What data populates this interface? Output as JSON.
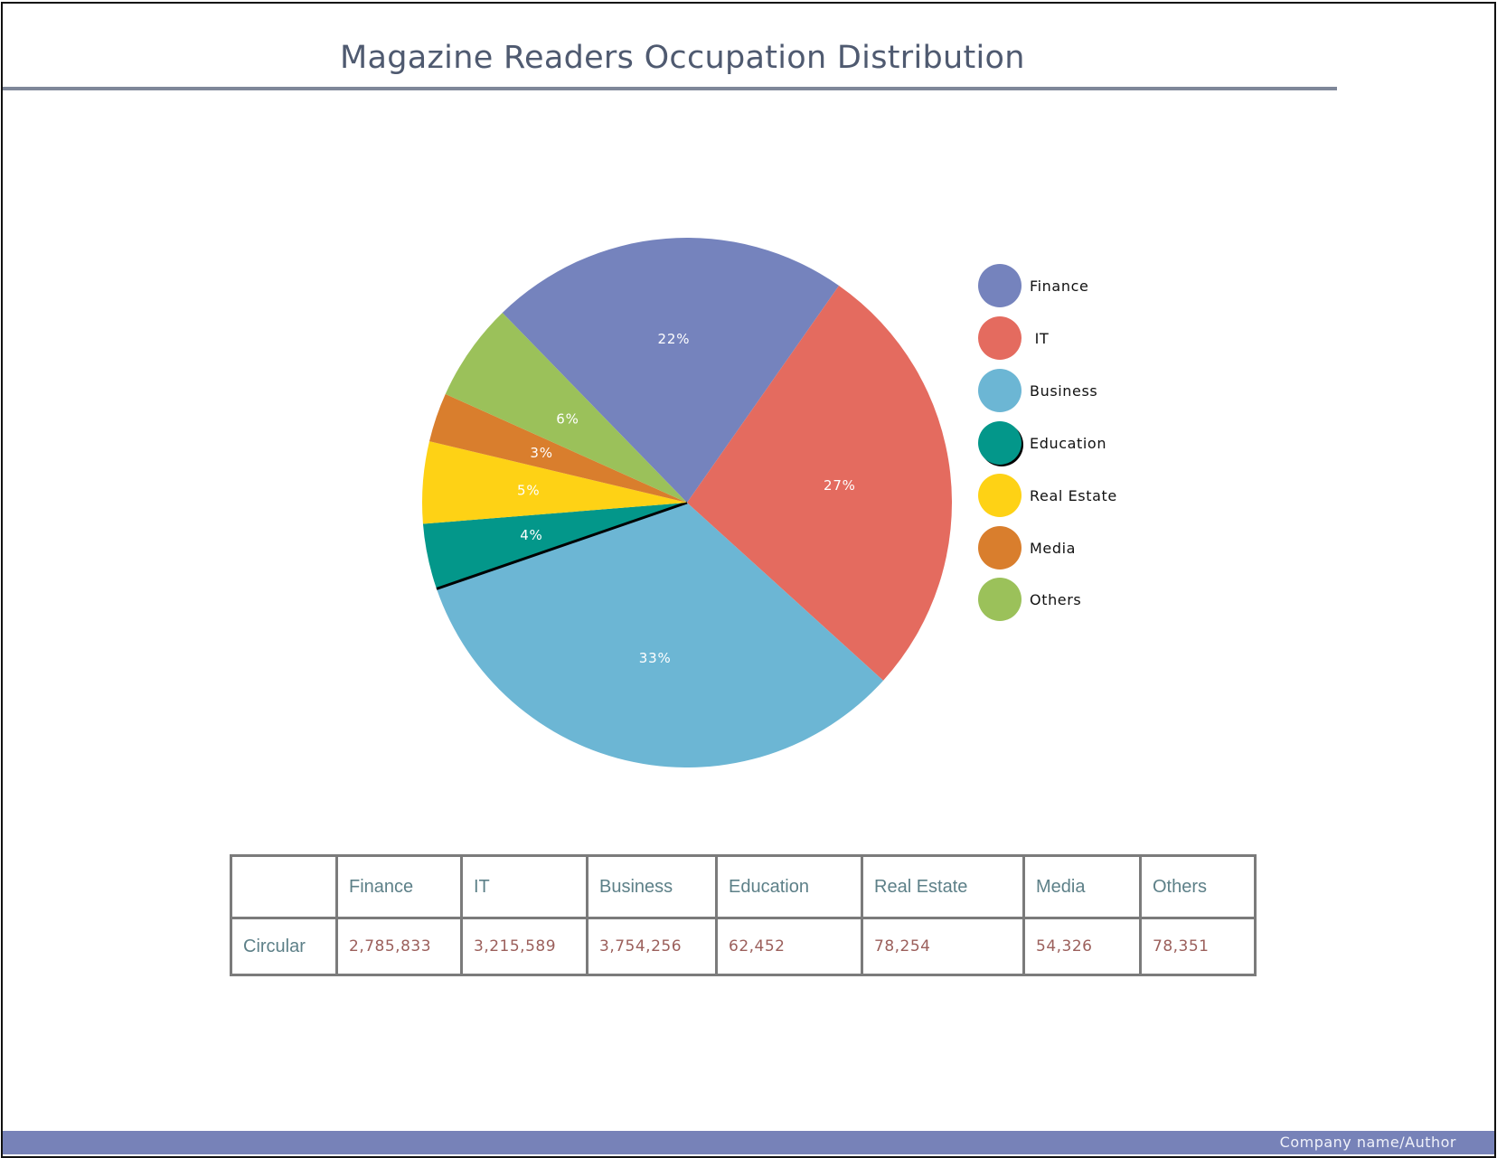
{
  "chart_data": {
    "type": "pie",
    "title": "Magazine Readers Occupation Distribution",
    "slices": [
      {
        "label": "Finance",
        "percent": 22,
        "value": 2785833,
        "color": "#7583bd"
      },
      {
        "label": "IT",
        "percent": 27,
        "value": 3215589,
        "color": "#e46b5f"
      },
      {
        "label": "Business",
        "percent": 33,
        "value": 3754256,
        "color": "#6cb6d4"
      },
      {
        "label": "Education",
        "percent": 4,
        "value": 62452,
        "color": "#03978a"
      },
      {
        "label": "Real Estate",
        "percent": 5,
        "value": 78254,
        "color": "#fed215"
      },
      {
        "label": "Media",
        "percent": 3,
        "value": 54326,
        "color": "#d97e2d"
      },
      {
        "label": "Others",
        "percent": 6,
        "value": 78351,
        "color": "#9bc15a"
      }
    ],
    "data_labels": [
      "22%",
      "27%",
      "33%",
      "4%",
      "5%",
      "3%",
      "6%"
    ],
    "legend_position": "right"
  },
  "legend": {
    "items": [
      {
        "label": "Finance",
        "color": "#7583bd"
      },
      {
        "label": "IT",
        "color": "#e46b5f"
      },
      {
        "label": "Business",
        "color": "#6cb6d4"
      },
      {
        "label": "Education",
        "color": "#03978a"
      },
      {
        "label": "Real Estate",
        "color": "#fed215"
      },
      {
        "label": "Media",
        "color": "#d97e2d"
      },
      {
        "label": "Others",
        "color": "#9bc15a"
      }
    ]
  },
  "table": {
    "headers": [
      "",
      "Finance",
      "IT",
      "Business",
      "Education",
      "Real Estate",
      "Media",
      "Others"
    ],
    "rows": [
      [
        "Circular",
        "2,785,833",
        "3,215,589",
        "3,754,256",
        "62,452",
        "78,254",
        "54,326",
        "78,351"
      ]
    ]
  },
  "footer": {
    "text": "Company  name/Author"
  }
}
